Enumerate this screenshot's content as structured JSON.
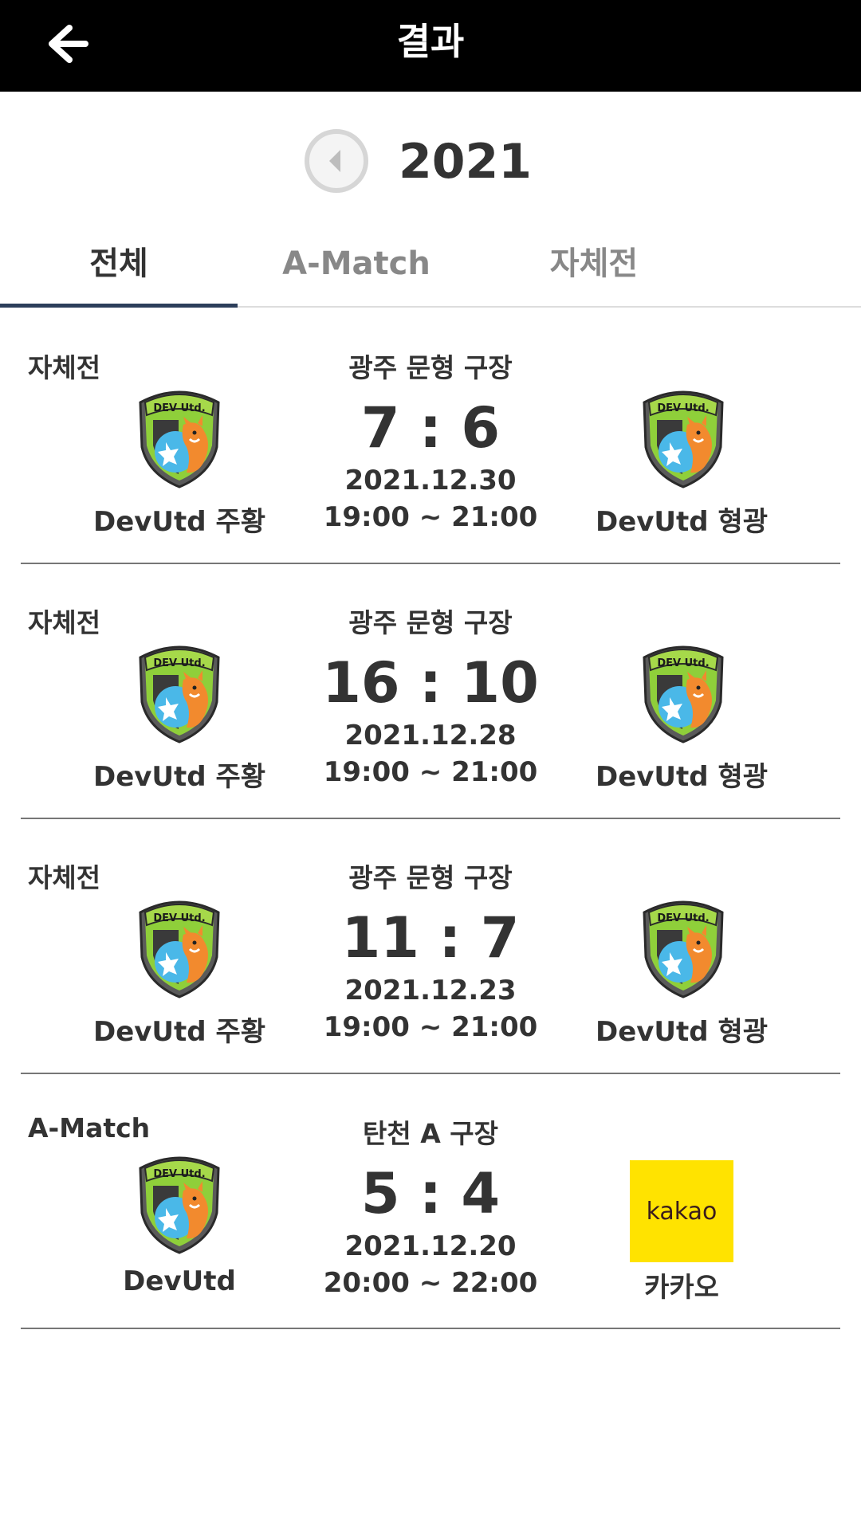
{
  "header": {
    "title": "결과",
    "back_icon": "arrow-left-icon"
  },
  "year_selector": {
    "prev_icon": "circle-chevron-left-icon",
    "year": "2021"
  },
  "tabs": [
    {
      "label": "전체",
      "active": true
    },
    {
      "label": "A-Match",
      "active": false
    },
    {
      "label": "자체전",
      "active": false
    }
  ],
  "matches": [
    {
      "type": "자체전",
      "venue": "광주 문형 구장",
      "score": "7 : 6",
      "date": "2021.12.30",
      "time": "19:00 ~ 21:00",
      "home": {
        "name": "DevUtd 주황",
        "logo": "devutd-crest"
      },
      "away": {
        "name": "DevUtd 형광",
        "logo": "devutd-crest"
      }
    },
    {
      "type": "자체전",
      "venue": "광주 문형 구장",
      "score": "16 : 10",
      "date": "2021.12.28",
      "time": "19:00 ~ 21:00",
      "home": {
        "name": "DevUtd 주황",
        "logo": "devutd-crest"
      },
      "away": {
        "name": "DevUtd 형광",
        "logo": "devutd-crest"
      }
    },
    {
      "type": "자체전",
      "venue": "광주 문형 구장",
      "score": "11 : 7",
      "date": "2021.12.23",
      "time": "19:00 ~ 21:00",
      "home": {
        "name": "DevUtd 주황",
        "logo": "devutd-crest"
      },
      "away": {
        "name": "DevUtd 형광",
        "logo": "devutd-crest"
      }
    },
    {
      "type": "A-Match",
      "venue": "탄천 A 구장",
      "score": "5 : 4",
      "date": "2021.12.20",
      "time": "20:00 ~ 22:00",
      "home": {
        "name": "DevUtd",
        "logo": "devutd-crest"
      },
      "away": {
        "name": "카카오",
        "logo": "kakao",
        "logo_text": "kakao"
      }
    }
  ],
  "colors": {
    "header_bg": "#000000",
    "tab_indicator": "#2c3e5a",
    "kakao_yellow": "#ffe300"
  }
}
